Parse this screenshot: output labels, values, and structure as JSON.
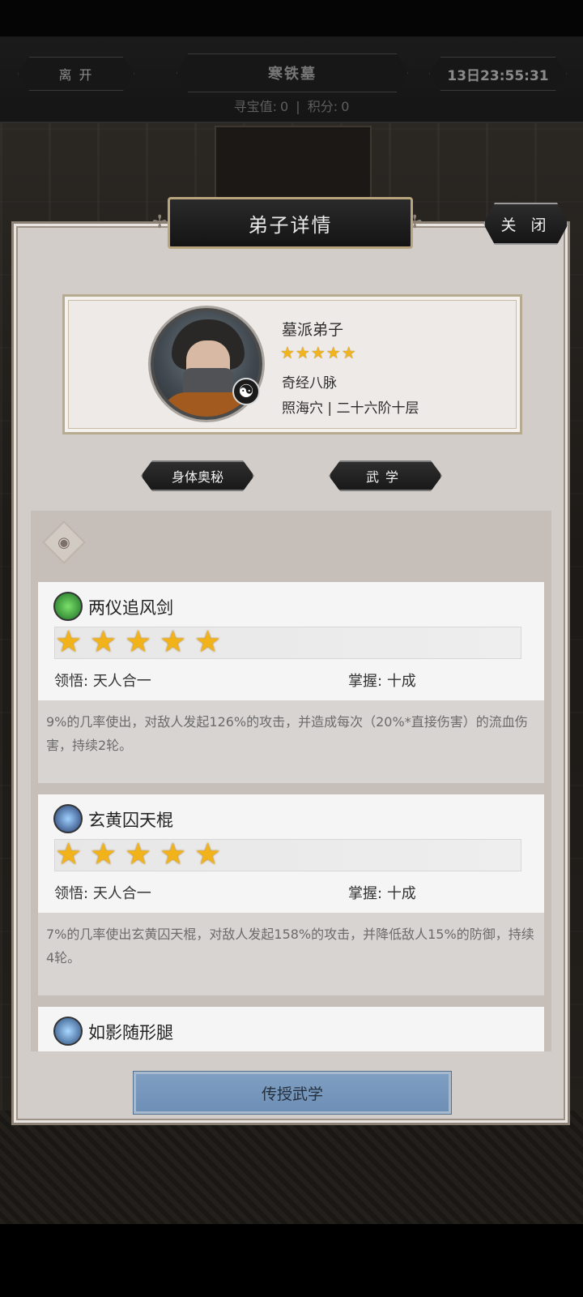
{
  "topbar": {
    "leave_label": "离 开",
    "title": "寒铁墓",
    "timer": "13日23:55:31",
    "treasure_label": "寻宝值:",
    "treasure_value": "0",
    "separator": "|",
    "points_label": "积分:",
    "points_value": "0"
  },
  "dialog": {
    "title": "弟子详情",
    "close_label": "关 闭"
  },
  "disciple": {
    "name": "墓派弟子",
    "stars": "★★★★★",
    "meridian": "奇经八脉",
    "progress": "照海穴 | 二十六阶十层",
    "star_count": 5
  },
  "tabs": {
    "body": "身体奥秘",
    "martial": "武学"
  },
  "skills": [
    {
      "name": "两仪追风剑",
      "icon": "sword-icon",
      "stars": 5,
      "comprehension_label": "领悟:",
      "comprehension": "天人合一",
      "mastery_label": "掌握:",
      "mastery": "十成",
      "description": "9%的几率使出，对敌人发起126%的攻击，并造成每次（20%*直接伤害）的流血伤害，持续2轮。"
    },
    {
      "name": "玄黄囚天棍",
      "icon": "staff-icon",
      "stars": 5,
      "comprehension_label": "领悟:",
      "comprehension": "天人合一",
      "mastery_label": "掌握:",
      "mastery": "十成",
      "description": "7%的几率使出玄黄囚天棍，对敌人发起158%的攻击，并降低敌人15%的防御，持续4轮。"
    },
    {
      "name": "如影随形腿",
      "icon": "kick-icon"
    }
  ],
  "teach_button": "传授武学",
  "colors": {
    "star": "#f2b21a",
    "button_blue": "#7f9ec2",
    "panel": "#d3cdca"
  }
}
